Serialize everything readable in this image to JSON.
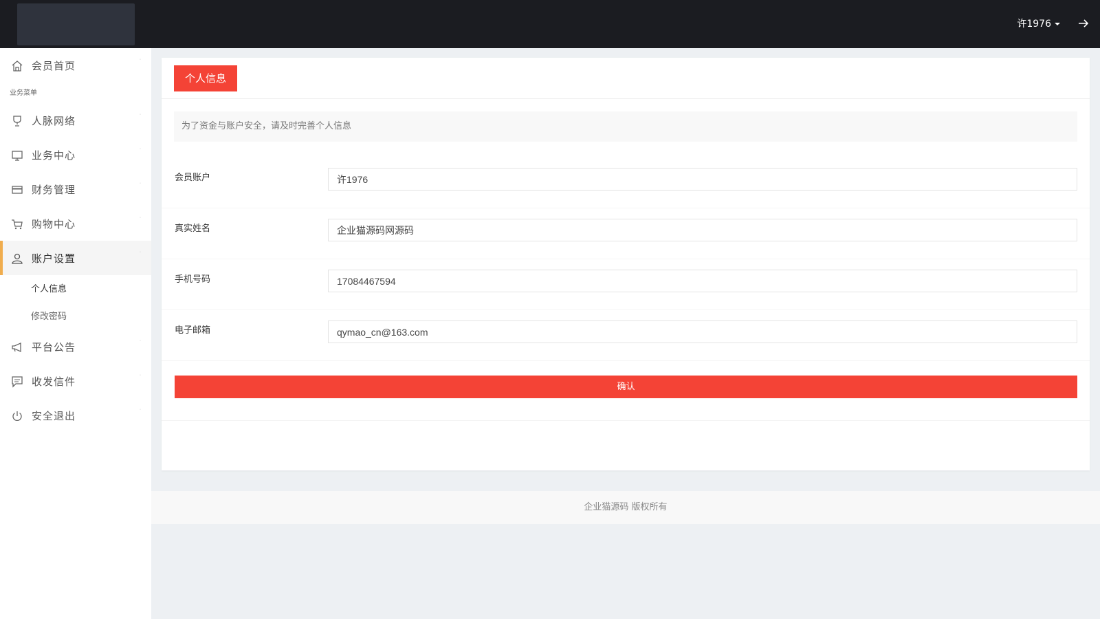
{
  "header": {
    "username": "许1976"
  },
  "sidebar": {
    "section_title": "业务菜单",
    "items": [
      {
        "label": "会员首页",
        "icon": "home-icon"
      },
      {
        "label": "人脉网络",
        "icon": "trophy-icon"
      },
      {
        "label": "业务中心",
        "icon": "monitor-icon"
      },
      {
        "label": "财务管理",
        "icon": "credit-card-icon"
      },
      {
        "label": "购物中心",
        "icon": "cart-icon"
      },
      {
        "label": "账户设置",
        "icon": "user-icon"
      },
      {
        "label": "平台公告",
        "icon": "megaphone-icon"
      },
      {
        "label": "收发信件",
        "icon": "message-icon"
      },
      {
        "label": "安全退出",
        "icon": "power-icon"
      }
    ],
    "subitems": [
      {
        "label": "个人信息"
      },
      {
        "label": "修改密码"
      }
    ]
  },
  "main": {
    "tab_label": "个人信息",
    "notice": "为了资金与账户安全，请及时完善个人信息",
    "fields": [
      {
        "label": "会员账户",
        "value": "许1976"
      },
      {
        "label": "真实姓名",
        "value": "企业猫源码网源码"
      },
      {
        "label": "手机号码",
        "value": "17084467594"
      },
      {
        "label": "电子邮箱",
        "value": "qymao_cn@163.com"
      }
    ],
    "confirm_label": "确认"
  },
  "footer": {
    "text": "企业猫源码 版权所有"
  },
  "colors": {
    "accent_red": "#f44336",
    "topbar": "#1b1c21",
    "active_indicator": "#f0ad4e"
  }
}
